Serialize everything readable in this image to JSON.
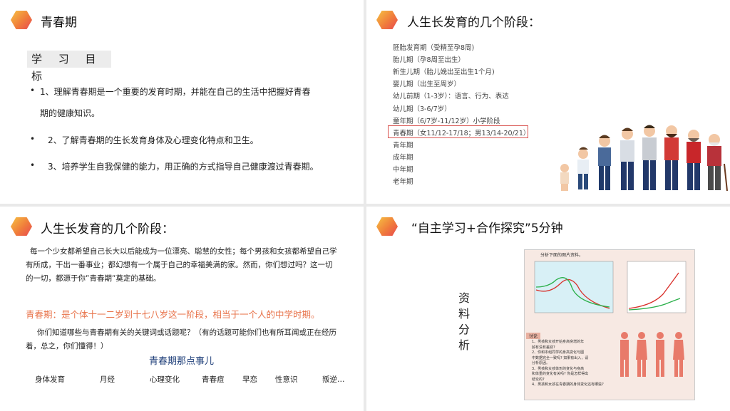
{
  "slide1": {
    "title": "青春期",
    "goal_heading": "学 习 目 标",
    "bullets": [
      {
        "dot": "•",
        "text": "1、理解青春期是一个重要的发育时期，并能在自己的生活中把握好青春",
        "cont": "期的健康知识。"
      },
      {
        "dot": "•",
        "text": "2、了解青春期的生长发育身体及心理变化特点和卫生。"
      },
      {
        "dot": "•",
        "text": "3、培养学生自我保健的能力，用正确的方式指导自己健康渡过青春期。"
      }
    ]
  },
  "slide2": {
    "title": "人生长发育的几个阶段：",
    "stages": [
      "胚胎发育期（受精至孕8周)",
      "胎儿期（孕8周至出生）",
      "新生儿期（胎儿娩出至出生1个月)",
      "婴儿期（出生至周岁）",
      "幼儿前期（1-3岁）：语言、行为、表达",
      "幼儿期（3-6/7岁）",
      "童年期（6/7岁-11/12岁）小学阶段",
      "青春期（女11/12-17/18；男13/14-20/21）",
      "青年期",
      "成年期",
      "中年期",
      "老年期"
    ]
  },
  "slide3": {
    "title": "人生长发育的几个阶段：",
    "para1_line1": "每一个少女都希望自己长大以后能成为一位漂亮、聪慧的女性；每个男孩和女孩都希望自己学",
    "para1_line2": "有所成，干出一番事业；都幻想有一个属于自己的幸福美满的家。然而，你们想过吗？这一切",
    "para1_line3": "的一切，都源于你“青春期“奠定的基础。",
    "definition": "青春期：是个体十一二岁到十七八岁这一阶段，相当于一个人的中学时期。",
    "para2_line1": "你们知道哪些与青春期有关的关键词或话题呢？（有的话题可能你们也有所耳闻或正在经历",
    "para2_line2": "着，总之，你们懂得！）",
    "subheading": "青春期那点事儿",
    "keywords": [
      {
        "text": "身体发育",
        "color": "#1f3f7a"
      },
      {
        "text": "月经",
        "color": "#d93b3b"
      },
      {
        "text": "心理变化",
        "color": "#e0707a"
      },
      {
        "text": "青春痘",
        "color": "#3aa6a8"
      },
      {
        "text": "早恋",
        "color": "#d98a3a"
      },
      {
        "text": "性意识",
        "color": "#8a2a2a"
      },
      {
        "text": "叛逆…",
        "color": "#6a3a8a"
      }
    ]
  },
  "slide4": {
    "title": "“自主学习+合作探究”5分钟",
    "side_label": "资料分析",
    "chart_caption": "分析下面的图片资料。",
    "questions_tag": "讨论",
    "questions": [
      "1、男孩和女孩开始身高突增的年",
      "龄有没有差别?",
      "2、你和本组同学的身高变化与图",
      "中数据完全一致吗? 如果有出入，请",
      "分析原因。",
      "3、男孩和女孩体形的变化与身高",
      "和体重的变化有关吗? 你是怎样得出",
      "结论的?",
      "4、男孩和女孩在青春期的身体变化还有哪些?"
    ]
  },
  "colors": {
    "accent_orange": "#f07d3b",
    "highlight_red": "#d9534f",
    "definition_orange": "#e8734a"
  }
}
